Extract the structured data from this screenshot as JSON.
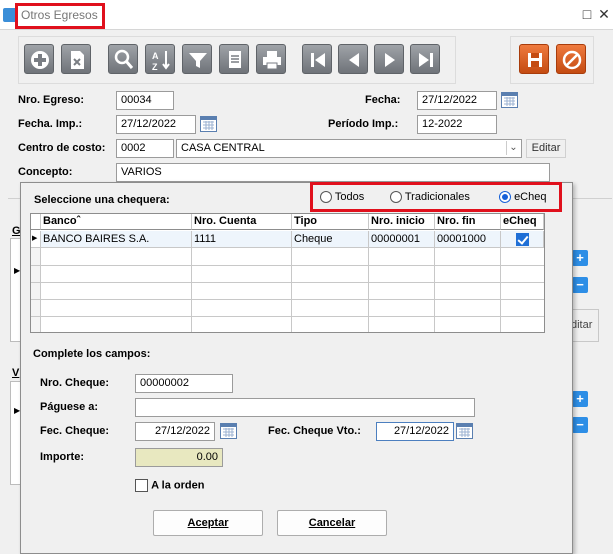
{
  "window": {
    "title": "Otros Egresos"
  },
  "toolbar": {
    "icons": [
      "add-icon",
      "delete-icon",
      "search-icon",
      "sort-icon",
      "filter-icon",
      "document-icon",
      "print-icon",
      "first-icon",
      "prev-icon",
      "next-icon",
      "last-icon"
    ],
    "right_icons": [
      "save-icon",
      "cancel-icon"
    ]
  },
  "form": {
    "nro_egreso": {
      "label": "Nro. Egreso:",
      "value": "00034"
    },
    "fecha": {
      "label": "Fecha:",
      "value": "27/12/2022"
    },
    "fecha_imp": {
      "label": "Fecha. Imp.:",
      "value": "27/12/2022"
    },
    "periodo_imp": {
      "label": "Período Imp.:",
      "value": "12-2022"
    },
    "centro_costo": {
      "label": "Centro de costo:",
      "code": "0002",
      "name": "CASA CENTRAL",
      "edit_label": "Editar"
    },
    "concepto": {
      "label": "Concepto:",
      "value": "VARIOS"
    },
    "bg_fragments": {
      "g": "G",
      "v": "V",
      "editar": "ditar"
    }
  },
  "dialog": {
    "prompt": "Seleccione una chequera:",
    "radios": [
      {
        "label": "Todos",
        "selected": false
      },
      {
        "label": "Tradicionales",
        "selected": false
      },
      {
        "label": "eCheq",
        "selected": true
      }
    ],
    "grid": {
      "columns": [
        "Banco",
        "Nro. Cuenta",
        "Tipo",
        "Nro. inicio",
        "Nro. fin",
        "eCheq"
      ],
      "rows": [
        {
          "banco": "BANCO BAIRES S.A.",
          "cuenta": "1111",
          "tipo": "Cheque",
          "inicio": "00000001",
          "fin": "00001000",
          "echeq": true
        }
      ]
    },
    "complete_label": "Complete los campos:",
    "nro_cheque": {
      "label": "Nro. Cheque:",
      "value": "00000002"
    },
    "paguese": {
      "label": "Páguese a:",
      "value": ""
    },
    "fec_cheque": {
      "label": "Fec. Cheque:",
      "value": "27/12/2022"
    },
    "fec_cheque_vto": {
      "label": "Fec. Cheque Vto.:",
      "value": "27/12/2022"
    },
    "importe": {
      "label": "Importe:",
      "value": "0.00"
    },
    "a_la_orden": {
      "label": "A la orden",
      "checked": false
    },
    "accept_label": "Aceptar",
    "cancel_label": "Cancelar"
  },
  "colors": {
    "highlight": "#e0101c",
    "accent": "#1560d8",
    "importe_bg": "#e8e8c0"
  }
}
